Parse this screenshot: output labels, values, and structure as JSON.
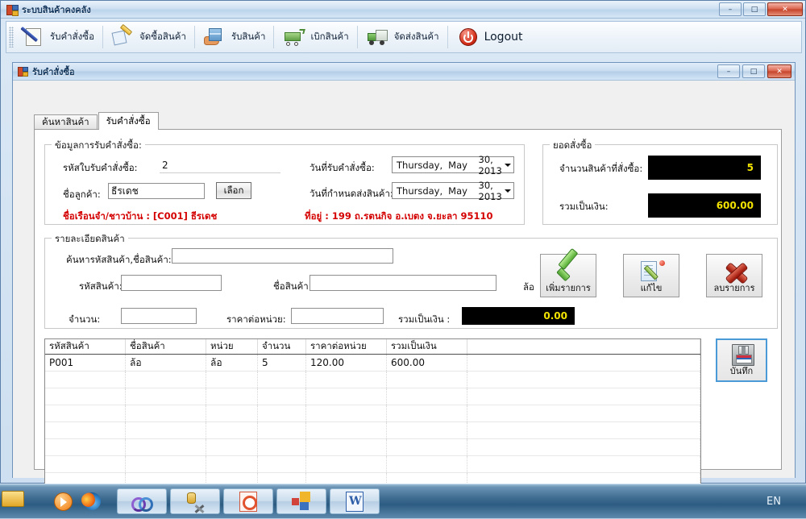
{
  "app": {
    "title": "ระบบสินค้าคงคลัง",
    "window_buttons": {
      "minimize": "–",
      "maximize": "□",
      "close": "✕"
    }
  },
  "toolbar": {
    "items": [
      {
        "label": "รับคำสั่งซื้อ",
        "icon": "order-notepad-pen-icon"
      },
      {
        "label": "จัดซื้อสินค้า",
        "icon": "purchase-paper-pencil-icon"
      },
      {
        "label": "รับสินค้า",
        "icon": "receive-hand-box-icon"
      },
      {
        "label": "เบิกสินค้า",
        "icon": "withdraw-cart-icon"
      },
      {
        "label": "จัดส่งสินค้า",
        "icon": "delivery-truck-icon"
      }
    ],
    "logout_label": "Logout",
    "logout_icon": "power-icon"
  },
  "mdi": {
    "title": "รับคำสั่งซื้อ",
    "window_buttons": {
      "minimize": "–",
      "maximize": "□",
      "close": "✕"
    }
  },
  "tabs": [
    {
      "label": "ค้นหาสินค้า",
      "active": false
    },
    {
      "label": "รับคำสั่งซื้อ",
      "active": true
    }
  ],
  "order_info": {
    "group_title": "ข้อมูลการรับคำสั่งซื้อ:",
    "receipt_code_label": "รหัสใบรับคำสั่งซื้อ:",
    "receipt_code_value": "2",
    "customer_label": "ชื่อลูกค้า:",
    "customer_value": "ธีรเดช",
    "select_button": "เลือก",
    "order_date_label": "วันที่รับคำสั่งซื้อ:",
    "order_date_value": {
      "day": "Thursday",
      "comma": ",",
      "month": "May",
      "rest": "30, 2013"
    },
    "due_date_label": "วันที่กำหนดส่งสินค้า:",
    "due_date_value": {
      "day": "Thursday",
      "comma": ",",
      "month": "May",
      "rest": "30, 2013"
    },
    "customer_info_red": "ชื่อเรือนจำ/ชาวบ้าน  : [C001] ธีรเดช",
    "address_red": "ที่อยู่ : 199 ถ.รตนกิจ อ.เบตง จ.ยะลา 95110"
  },
  "totals": {
    "group_title": "ยอดสั่งซื้อ",
    "qty_label": "จำนวนสินค้าที่สั่งซื้อ:",
    "qty_value": "5",
    "amount_label": "รวมเป็นเงิน:",
    "amount_value": "600.00"
  },
  "product_detail": {
    "group_title": "รายละเอียดสินค้า",
    "search_label": "ค้นหารหัสสินค้า,ชื่อสินค้า:",
    "search_value": "",
    "code_label": "รหัสสินค้า:",
    "code_value": "",
    "name_label": "ชื่อสินค้า:",
    "name_value": "",
    "unit_value": "ล้อ",
    "qty_label": "จำนวน:",
    "qty_value": "",
    "price_label": "ราคาต่อหน่วย:",
    "price_value": "",
    "total_label": "รวมเป็นเงิน :",
    "total_value": "0.00",
    "buttons": [
      {
        "label": "เพิ่มรายการ",
        "icon": "green-check-icon"
      },
      {
        "label": "แก้ไข",
        "icon": "edit-pencil-icon"
      },
      {
        "label": "ลบรายการ",
        "icon": "red-x-icon"
      }
    ]
  },
  "grid": {
    "columns": [
      "รหัสสินค้า",
      "ชื่อสินค้า",
      "หน่วย",
      "จำนวน",
      "ราคาต่อหน่วย",
      "รวมเป็นเงิน",
      ""
    ],
    "rows": [
      {
        "cells": [
          "P001",
          "ล้อ",
          "ล้อ",
          "5",
          "120.00",
          "600.00",
          ""
        ]
      }
    ],
    "empty_row_count": 7
  },
  "save": {
    "label": "บันทึก",
    "icon": "floppy-save-icon"
  },
  "taskbar": {
    "start_icon": "start-folder-icon",
    "quick_launch": [
      {
        "icon": "media-player-icon"
      },
      {
        "icon": "firefox-icon"
      }
    ],
    "task_items": [
      {
        "icon": "visual-studio-icon"
      },
      {
        "icon": "database-tools-icon"
      },
      {
        "icon": "powerpoint-icon"
      },
      {
        "icon": "colored-squares-icon"
      },
      {
        "icon": "word-icon"
      }
    ],
    "tray_language": "EN"
  },
  "colors": {
    "accent": "#3f6c91",
    "value_text": "#f2e200",
    "red_text": "#d40000",
    "black_panel": "#000000"
  }
}
